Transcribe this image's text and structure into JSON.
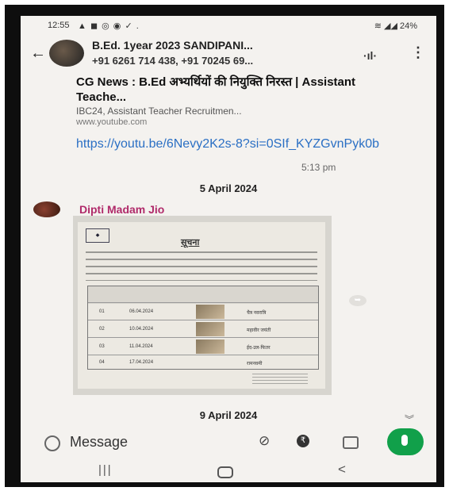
{
  "status_bar": {
    "time": "12:55",
    "battery": "24%"
  },
  "chat_header": {
    "title": "B.Ed. 1year 2023 SANDIPANI...",
    "subtitle": "+91 6261 714 438, +91 70245 69..."
  },
  "link_message": {
    "preview_title": "CG News : B.Ed अभ्यर्थियों की नियुक्ति निरस्त | Assistant Teache...",
    "preview_description": "IBC24, Assistant Teacher Recruitmen...",
    "preview_domain": "www.youtube.com",
    "url": "https://youtu.be/6Nevy2K2s-8?si=0SIf_KYZGvnPyk0b",
    "time": "5:13 pm"
  },
  "date_separators": [
    "5 April 2024",
    "9 April 2024"
  ],
  "image_message": {
    "sender": "Dipti Madam Jio",
    "notice_heading": "सूचना",
    "table_rows": [
      {
        "no": "01",
        "date": "06.04.2024",
        "name": "चैत्र नवरात्रि"
      },
      {
        "no": "02",
        "date": "10.04.2024",
        "name": "महावीर जयंती"
      },
      {
        "no": "03",
        "date": "11.04.2024",
        "name": "ईद-उल-फितर"
      },
      {
        "no": "04",
        "date": "17.04.2024",
        "name": "रामनवमी"
      }
    ]
  },
  "composer": {
    "placeholder": "Message"
  },
  "colors": {
    "link": "#2a6fc4",
    "sender_name": "#b02a6a",
    "mic_button": "#11a04a"
  }
}
